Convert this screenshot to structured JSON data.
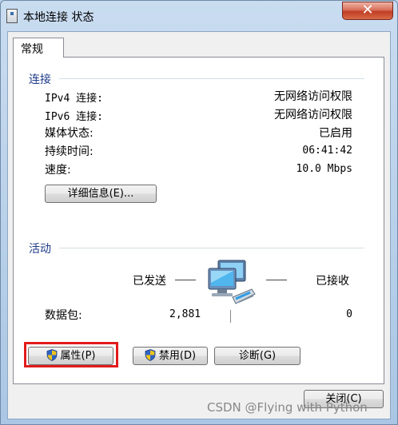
{
  "window": {
    "title": "本地连接 状态",
    "close_label": "✕"
  },
  "tabs": [
    {
      "label": "常规"
    }
  ],
  "connection": {
    "heading": "连接",
    "rows": [
      {
        "label": "IPv4 连接:",
        "value": "无网络访问权限"
      },
      {
        "label": "IPv6 连接:",
        "value": "无网络访问权限"
      },
      {
        "label": "媒体状态:",
        "value": "已启用"
      },
      {
        "label": "持续时间:",
        "value": "06:41:42"
      },
      {
        "label": "速度:",
        "value": "10.0 Mbps"
      }
    ],
    "details_button": "详细信息(E)..."
  },
  "activity": {
    "heading": "活动",
    "sent_label": "已发送",
    "received_label": "已接收",
    "packets_label": "数据包:",
    "packets_sent": "2,881",
    "packets_received": "0"
  },
  "buttons": {
    "properties": "属性(P)",
    "disable": "禁用(D)",
    "diagnose": "诊断(G)",
    "close": "关闭(C)"
  },
  "watermark": "CSDN @Flying with Python",
  "icons": {
    "title": "network-status-icon",
    "network": "network-computers-icon",
    "shield": "uac-shield-icon"
  },
  "colors": {
    "highlight": "#e21b1b",
    "section_heading": "#1e3b8a"
  }
}
